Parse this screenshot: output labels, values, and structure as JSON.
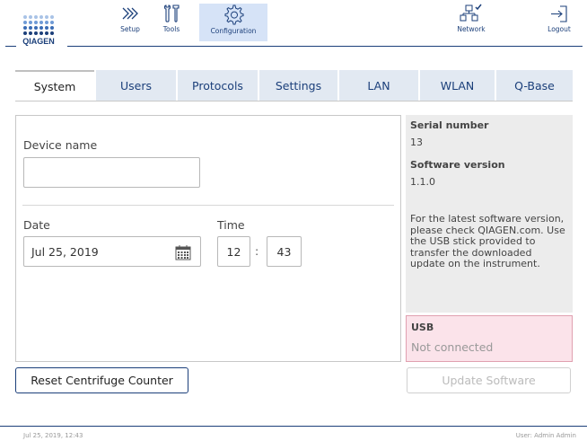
{
  "brand": {
    "logo_text": "QIAGEN",
    "color": "#1b3f7a"
  },
  "nav": {
    "setup": {
      "label": "Setup",
      "icon": "chevrons-right-icon"
    },
    "tools": {
      "label": "Tools",
      "icon": "tools-icon"
    },
    "configuration": {
      "label": "Configuration",
      "icon": "gear-icon",
      "active": true
    },
    "network": {
      "label": "Network",
      "icon": "network-icon"
    },
    "logout": {
      "label": "Logout",
      "icon": "logout-icon"
    }
  },
  "tabs": [
    {
      "label": "System",
      "active": true
    },
    {
      "label": "Users"
    },
    {
      "label": "Protocols"
    },
    {
      "label": "Settings"
    },
    {
      "label": "LAN"
    },
    {
      "label": "WLAN"
    },
    {
      "label": "Q-Base"
    }
  ],
  "form": {
    "device_name_label": "Device name",
    "device_name_value": "",
    "date_label": "Date",
    "date_value": "Jul 25, 2019",
    "time_label": "Time",
    "time_hour": "12",
    "time_sep": ":",
    "time_minute": "43"
  },
  "info": {
    "serial_label": "Serial number",
    "serial_value": "13",
    "software_label": "Software version",
    "software_value": "1.1.0",
    "note": "For the latest software version, please check QIAGEN.com. Use the USB stick provided to transfer the downloaded update on the instrument."
  },
  "usb": {
    "label": "USB",
    "status": "Not connected"
  },
  "buttons": {
    "reset": "Reset Centrifuge Counter",
    "update": "Update Software"
  },
  "footer": {
    "datetime": "Jul 25, 2019, 12:43",
    "user": "User: Admin Admin"
  }
}
